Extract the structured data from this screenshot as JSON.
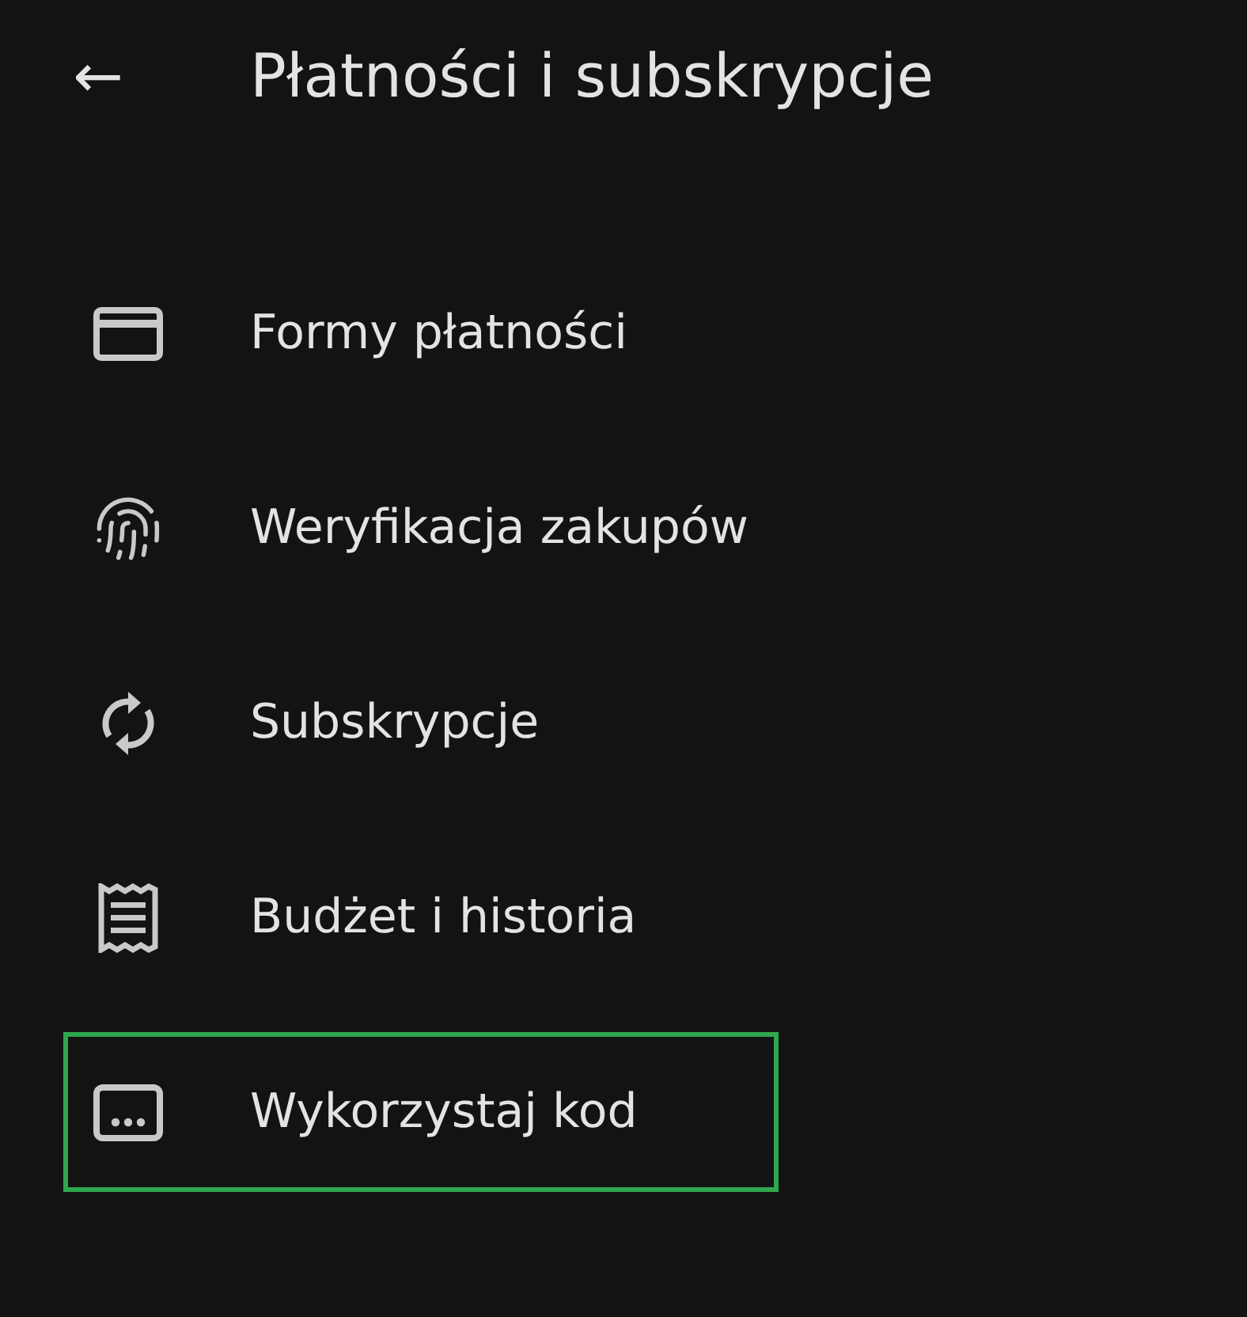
{
  "header": {
    "back": "←",
    "title": "Płatności i subskrypcje"
  },
  "items": [
    {
      "kind": "card",
      "label": "Formy płatności",
      "highlighted": false
    },
    {
      "kind": "fingerprint",
      "label": "Weryfikacja zakupów",
      "highlighted": false
    },
    {
      "kind": "sync",
      "label": "Subskrypcje",
      "highlighted": false
    },
    {
      "kind": "receipt",
      "label": "Budżet i historia",
      "highlighted": false
    },
    {
      "kind": "code",
      "label": "Wykorzystaj kod",
      "highlighted": true
    }
  ]
}
